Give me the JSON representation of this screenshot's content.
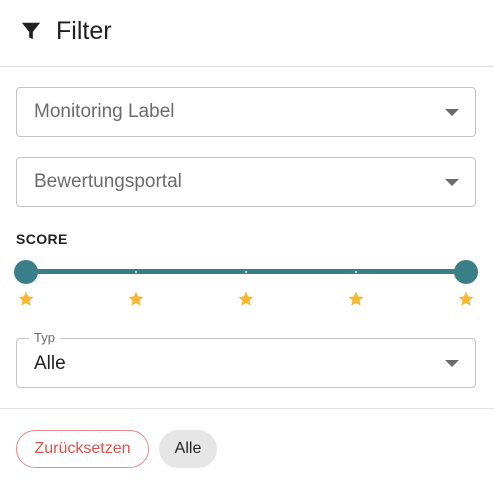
{
  "header": {
    "title": "Filter",
    "icon": "filter-icon"
  },
  "filters": {
    "monitoring_label": {
      "placeholder": "Monitoring Label"
    },
    "portal": {
      "placeholder": "Bewertungsportal"
    },
    "score": {
      "label": "SCORE",
      "min": 1,
      "max": 5,
      "selected_range": [
        1,
        5
      ],
      "marks": [
        1,
        2,
        3,
        4,
        5
      ],
      "mark_icon": "star-icon"
    },
    "typ": {
      "label": "Typ",
      "value": "Alle"
    }
  },
  "actions": {
    "reset_label": "Zurücksetzen"
  },
  "active_chips": [
    "Alle"
  ],
  "colors": {
    "slider": "#3a7f88",
    "star": "#f5b82e",
    "reset": "#d9534f"
  }
}
